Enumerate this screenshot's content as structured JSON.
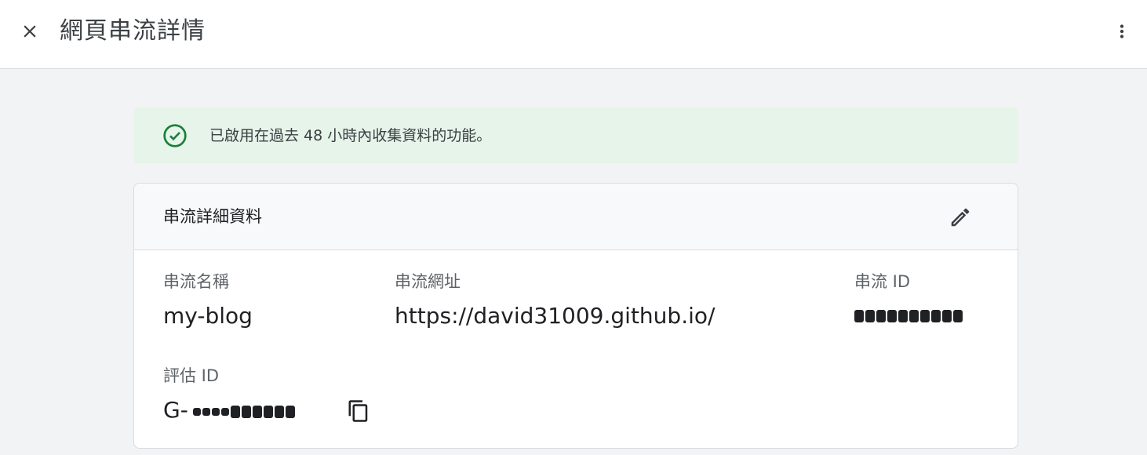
{
  "header": {
    "title": "網頁串流詳情",
    "close_icon": "close-icon",
    "more_icon": "more-vert-icon"
  },
  "banner": {
    "message": "已啟用在過去 48 小時內收集資料的功能。",
    "icon": "check-circle-icon",
    "color": "#188038"
  },
  "card": {
    "title": "串流詳細資料",
    "edit_icon": "edit-icon",
    "stream_name_label": "串流名稱",
    "stream_name_value": "my-blog",
    "stream_url_label": "串流網址",
    "stream_url_value": "https://david31009.github.io/",
    "stream_id_label": "串流 ID",
    "measurement_id_label": "評估 ID",
    "measurement_id_prefix": "G-",
    "copy_icon": "copy-icon"
  }
}
